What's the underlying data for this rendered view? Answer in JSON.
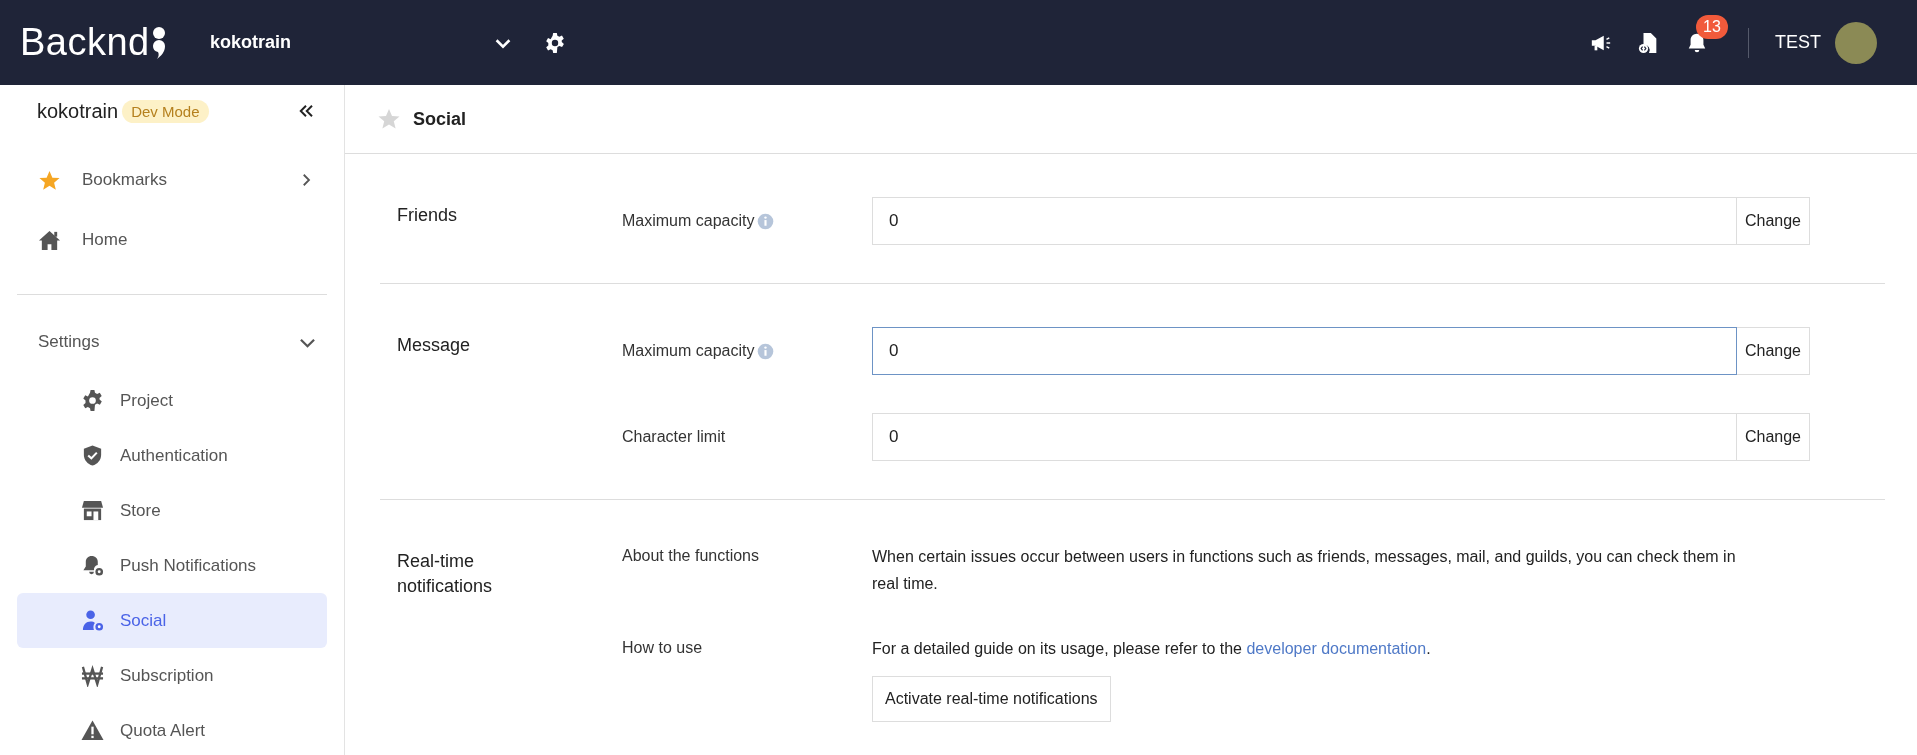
{
  "header": {
    "logo": "Backnd",
    "project": "kokotrain",
    "notifications": "13",
    "user": "TEST"
  },
  "sidebar": {
    "project": "kokotrain",
    "mode": "Dev Mode",
    "items": [
      {
        "label": "Bookmarks",
        "kind": "submenu"
      },
      {
        "label": "Home",
        "kind": "link"
      }
    ],
    "groups": [
      {
        "label": "Settings",
        "expanded": true,
        "children": [
          {
            "label": "Project",
            "selected": false
          },
          {
            "label": "Authentication",
            "selected": false
          },
          {
            "label": "Store",
            "selected": false
          },
          {
            "label": "Push Notifications",
            "selected": false
          },
          {
            "label": "Social",
            "selected": true
          },
          {
            "label": "Subscription",
            "selected": false
          },
          {
            "label": "Quota Alert",
            "selected": false
          }
        ]
      }
    ]
  },
  "page": {
    "title": "Social",
    "bookmarked": false
  },
  "sections": [
    {
      "title": "Friends",
      "rows": [
        {
          "kind": "input",
          "label": "Maximum capacity",
          "info": true,
          "value": "0",
          "focused": false,
          "button": "Change"
        }
      ]
    },
    {
      "title": "Message",
      "rows": [
        {
          "kind": "input",
          "label": "Maximum capacity",
          "info": true,
          "value": "0",
          "focused": true,
          "button": "Change"
        },
        {
          "kind": "input",
          "label": "Character limit",
          "info": false,
          "value": "0",
          "focused": false,
          "button": "Change"
        }
      ]
    },
    {
      "title": "Real-time notifications",
      "rows": [
        {
          "kind": "text",
          "label": "About the functions",
          "text": "When certain issues occur between users in functions such as friends, messages, mail, and guilds, you can check them in real time."
        },
        {
          "kind": "link",
          "label": "How to use",
          "text": "For a detailed guide on its usage, please refer to the ",
          "link": "developer documentation",
          "after": ".",
          "button": "Activate real-time notifications"
        }
      ]
    }
  ]
}
